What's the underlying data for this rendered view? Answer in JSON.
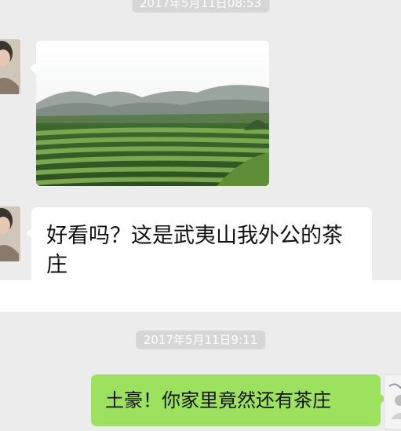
{
  "conversation": {
    "timestamp_1": "2017年5月11日08:53",
    "timestamp_2": "2017年5月11日9:11",
    "messages": [
      {
        "sender": "friend",
        "type": "image",
        "image": "tea-plantation-photo"
      },
      {
        "sender": "friend",
        "type": "text",
        "text": "好看吗？这是武夷山我外公的茶庄"
      },
      {
        "sender": "self",
        "type": "text",
        "text": "土豪！你家里竟然还有茶庄"
      }
    ]
  },
  "colors": {
    "chat_background": "#ececec",
    "timestamp_pill": "#d6d6d6",
    "incoming_bubble": "#ffffff",
    "outgoing_bubble": "#9de25e"
  }
}
